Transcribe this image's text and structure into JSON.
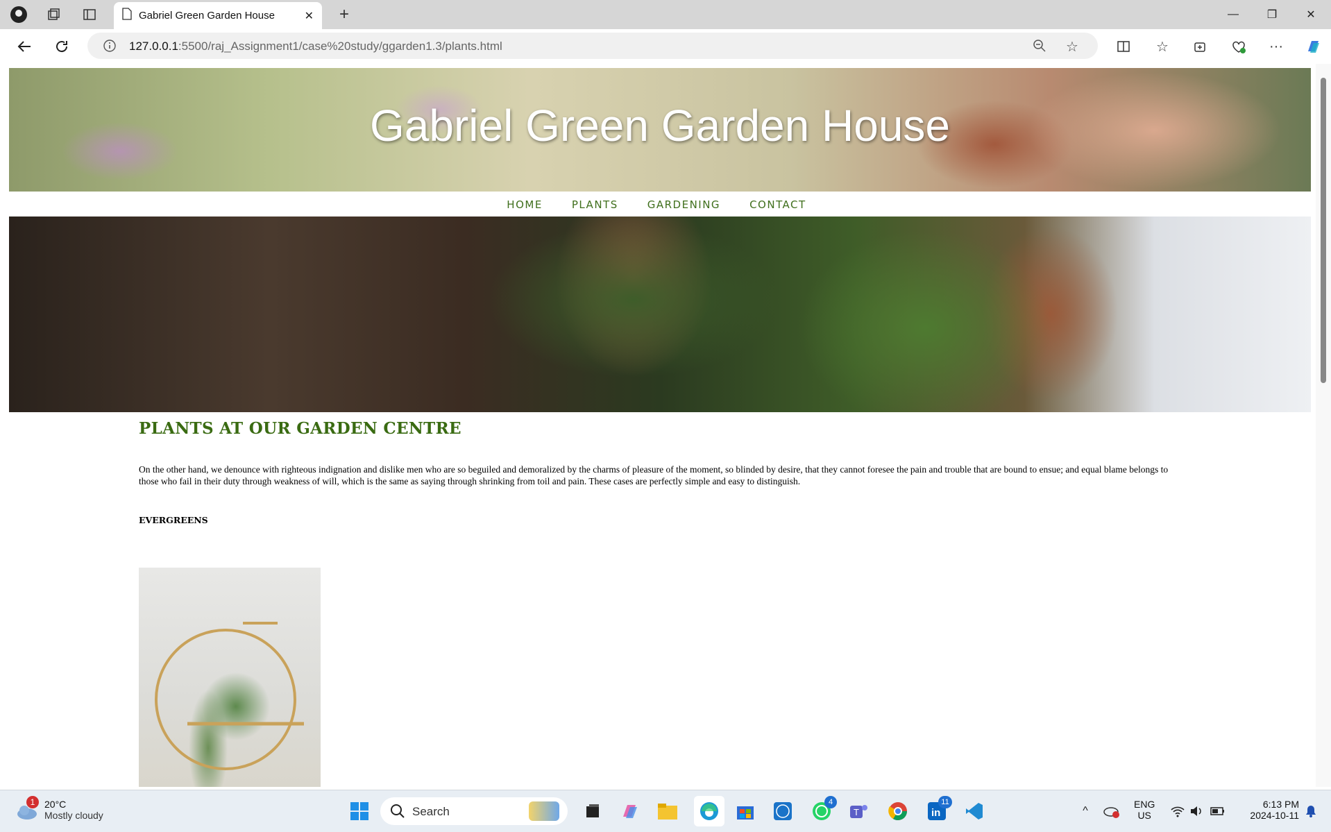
{
  "browser": {
    "tab_title": "Gabriel Green Garden House",
    "url_host": "127.0.0.1",
    "url_rest": ":5500/raj_Assignment1/case%20study/ggarden1.3/plants.html"
  },
  "site": {
    "title": "Gabriel Green Garden House",
    "nav": [
      "HOME",
      "PLANTS",
      "GARDENING",
      "CONTACT"
    ],
    "heading": "PLANTS AT OUR GARDEN CENTRE",
    "paragraph": "On the other hand, we denounce with righteous indignation and dislike men who are so beguiled and demoralized by the charms of pleasure of the moment, so blinded by desire, that they cannot foresee the pain and trouble that are bound to ensue; and equal blame belongs to those who fail in their duty through weakness of will, which is the same as saying through shrinking from toil and pain. These cases are perfectly simple and easy to distinguish.",
    "subheading": "EVERGREENS"
  },
  "taskbar": {
    "weather_temp": "20°C",
    "weather_desc": "Mostly cloudy",
    "weather_badge": "1",
    "search_placeholder": "Search",
    "lang_top": "ENG",
    "lang_bottom": "US",
    "time": "6:13 PM",
    "date": "2024-10-11",
    "whatsapp_badge": "4",
    "linkedin_badge": "11"
  },
  "colors": {
    "nav_green": "#3f6f1c",
    "heading_green": "#3a6b12"
  }
}
